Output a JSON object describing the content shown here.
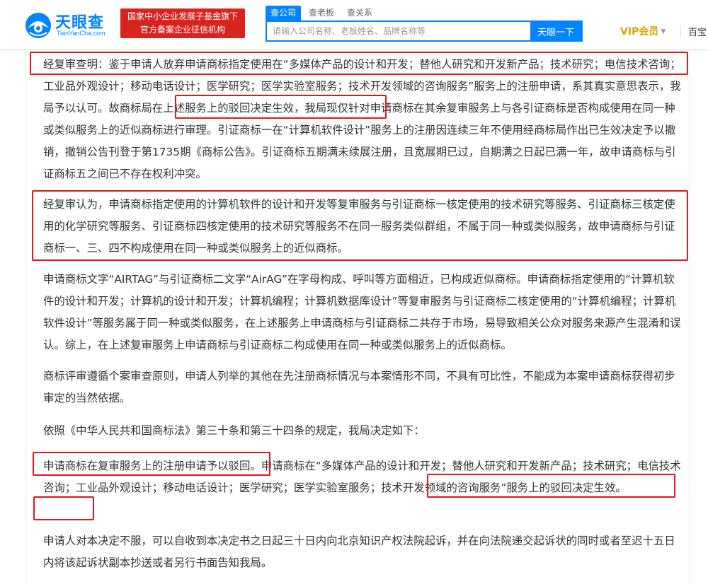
{
  "header": {
    "logo_name": "天眼查",
    "logo_domain": "TianYanCha.com",
    "banner_line1": "国家中小企业发展子基金旗下",
    "banner_line2": "官方备案企业征信机构",
    "tabs": [
      {
        "label": "查公司"
      },
      {
        "label": "查老板"
      },
      {
        "label": "查关系"
      }
    ],
    "search_placeholder": "请输入公司名称、老板姓名、品牌名称等",
    "search_button": "天眼一下",
    "vip_label": "VIP会员",
    "more_label": "百宝"
  },
  "paragraphs": [
    "经复审查明：鉴于申请人放弃申请商标指定使用在“多媒体产品的设计和开发；替他人研究和开发新产品；技术研究；电信技术咨询；工业品外观设计；移动电话设计；医学研究；医学实验室服务；技术开发领域的咨询服务”服务上的注册申请，系其真实意思表示，我局予以认可。故商标局在上述服务上的驳回决定生效，我局现仅针对申请商标在其余复审服务上与各引证商标是否构成使用在同一种或类似服务上的近似商标进行审理。引证商标一在“计算机软件设计”服务上的注册因连续三年不使用经商标局作出已生效决定予以撤销，撤销公告刊登于第1735期《商标公告》。引证商标五期满未续展注册，且宽展期已过，自期满之日起已满一年，故申请商标与引证商标五之间已不存在权利冲突。",
    "经复审认为，申请商标指定使用的计算机软件的设计和开发等复审服务与引证商标一核定使用的技术研究等服务、引证商标三核定使用的化学研究等服务、引证商标四核定使用的技术研究等服务不在同一服务类似群组，不属于同一种或类似服务，故申请商标与引证商标一、三、四不构成使用在同一种或类似服务上的近似商标。",
    "申请商标文字“AIRTAG”与引证商标二文字“AirAG”在字母构成、呼叫等方面相近，已构成近似商标。申请商标指定使用的“计算机软件的设计和开发；计算机的设计和开发；计算机编程；计算机数据库设计”等复审服务与引证商标二核定使用的“计算机编程；计算机软件设计”等服务属于同一种或类似服务，在上述服务上申请商标与引证商标二共存于市场，易导致相关公众对服务来源产生混淆和误认。综上，在上述复审服务上申请商标与引证商标二构成使用在同一种或类似服务上的近似商标。",
    "商标评审遵循个案审查原则，申请人列举的其他在先注册商标情况与本案情形不同，不具有可比性，不能成为本案申请商标获得初步审定的当然依据。",
    "依照《中华人民共和国商标法》第三十条和第三十四条的规定，我局决定如下：",
    "申请商标在复审服务上的注册申请予以驳回。申请商标在“多媒体产品的设计和开发；替他人研究和开发新产品；技术研究；电信技术咨询；工业品外观设计；移动电话设计；医学研究；医学实验室服务；技术开发领域的咨询服务”服务上的驳回决定生效。",
    "申请人对本决定不服，可以自收到本决定书之日起三十日内向北京知识产权法院起诉，并在向法院递交起诉状的同时或者至迟十五日内将该起诉状副本抄送或者另行书面告知我局。"
  ],
  "colors": {
    "brand_blue": "#0084ff",
    "banner_red": "#d8241f",
    "highlight_red": "#e0161c",
    "vip_gold": "#e0a100"
  }
}
